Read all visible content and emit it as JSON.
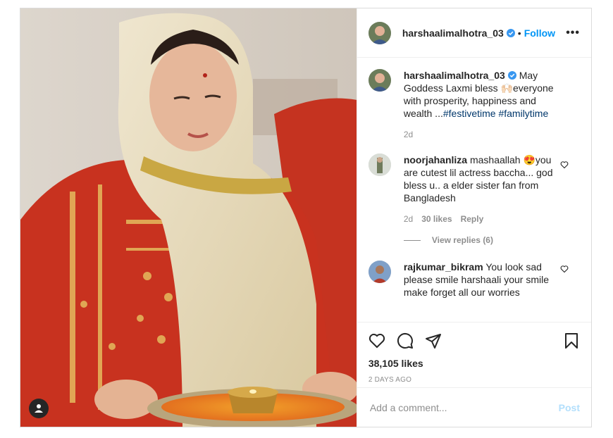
{
  "post": {
    "author": {
      "username": "harshaalimalhotra_03",
      "verified": true,
      "follow_label": "Follow",
      "more_label": "•••"
    },
    "caption": {
      "username": "harshaalimalhotra_03",
      "text_start": "May Goddess Laxmi bless ",
      "emoji": "🙌🏻",
      "text_end": "everyone with prosperity, happiness and wealth ...",
      "hashtags": [
        "#festivetime",
        "#familytime"
      ],
      "age": "2d"
    },
    "comments": [
      {
        "username": "noorjahanliza",
        "text_start": "mashaallah ",
        "emoji": "😍",
        "text_end": "you are cutest lil actress baccha... god bless u.. a elder sister fan from Bangladesh",
        "age": "2d",
        "likes": "30 likes",
        "reply_label": "Reply",
        "view_replies": "View replies (6)"
      },
      {
        "username": "rajkumar_bikram",
        "text": "You look sad please smile harshaali your smile make forget all our worries"
      }
    ],
    "likes": "38,105 likes",
    "date": "2 DAYS AGO",
    "add_comment_placeholder": "Add a comment...",
    "post_label": "Post",
    "colors": {
      "accent": "#0095f6",
      "hashtag": "#00376b",
      "muted": "#8e8e8e",
      "post_disabled": "#b2dffc"
    },
    "icons": [
      "heart-icon",
      "comment-icon",
      "share-icon",
      "bookmark-icon",
      "user-tag-icon",
      "verified-icon",
      "more-icon"
    ]
  }
}
